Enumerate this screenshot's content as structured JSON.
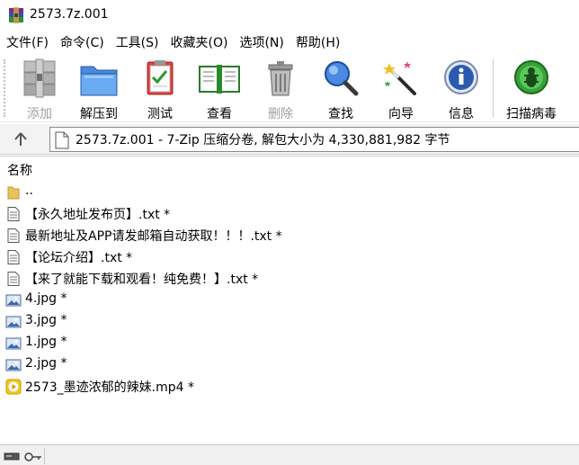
{
  "window": {
    "title": "2573.7z.001"
  },
  "menu": [
    {
      "label": "文件(F)"
    },
    {
      "label": "命令(C)"
    },
    {
      "label": "工具(S)"
    },
    {
      "label": "收藏夹(O)"
    },
    {
      "label": "选项(N)"
    },
    {
      "label": "帮助(H)"
    }
  ],
  "toolbar": {
    "add": "添加",
    "extract_to": "解压到",
    "test": "测试",
    "view": "查看",
    "delete": "删除",
    "find": "查找",
    "wizard": "向导",
    "info": "信息",
    "scan": "扫描病毒"
  },
  "address": {
    "text": "2573.7z.001 - 7-Zip 压缩分卷, 解包大小为 4,330,881,982 字节"
  },
  "list": {
    "column_name": "名称",
    "items": [
      {
        "name": "..",
        "icon": "folder-icon"
      },
      {
        "name": "【永久地址发布页】.txt *",
        "icon": "text-file-icon"
      },
      {
        "name": "最新地址及APP请发邮箱自动获取！！！.txt *",
        "icon": "text-file-icon"
      },
      {
        "name": "【论坛介绍】.txt *",
        "icon": "text-file-icon"
      },
      {
        "name": "【来了就能下载和观看！纯免费！】.txt *",
        "icon": "text-file-icon"
      },
      {
        "name": "4.jpg *",
        "icon": "image-file-icon"
      },
      {
        "name": "3.jpg *",
        "icon": "image-file-icon"
      },
      {
        "name": "1.jpg *",
        "icon": "image-file-icon"
      },
      {
        "name": "2.jpg *",
        "icon": "image-file-icon"
      },
      {
        "name": "2573_墨迹浓郁的辣妹.mp4 *",
        "icon": "video-file-icon"
      }
    ]
  }
}
